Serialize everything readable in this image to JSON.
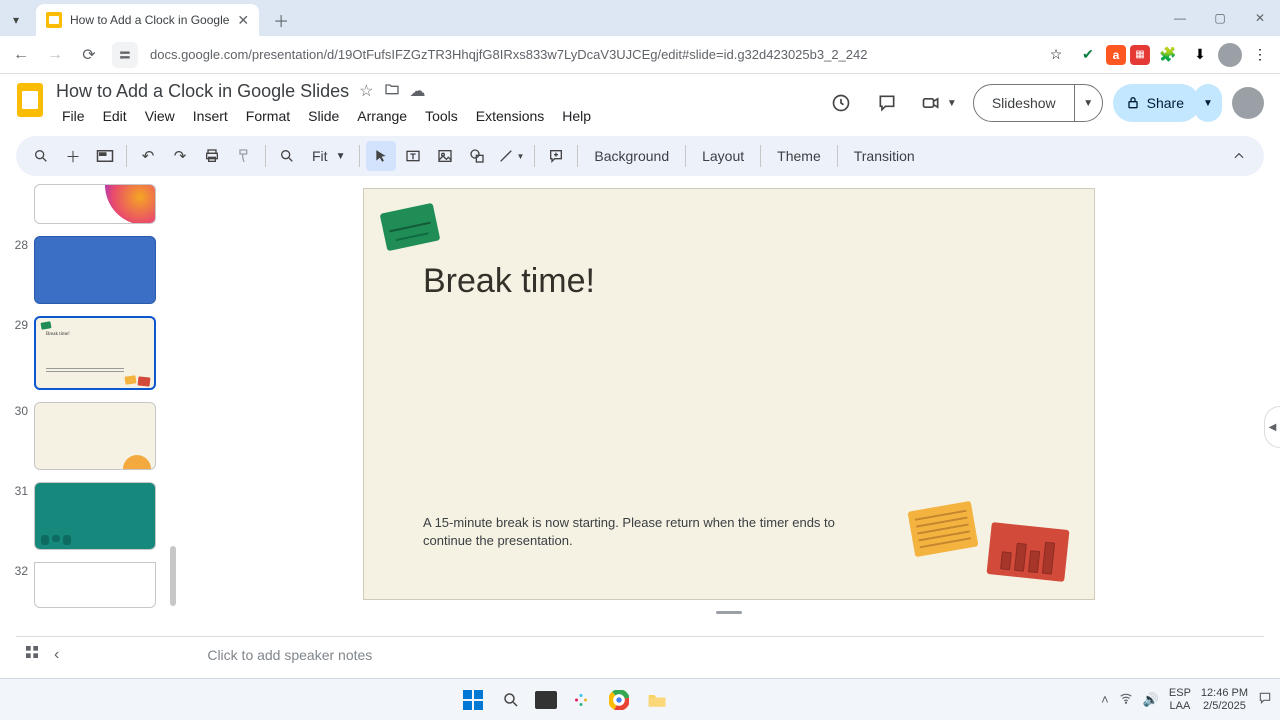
{
  "browser": {
    "tab_title": "How to Add a Clock in Google",
    "url": "docs.google.com/presentation/d/19OtFufsIFZGzTR3HhqjfG8IRxs833w7LyDcaV3UJCEg/edit#slide=id.g32d423025b3_2_242"
  },
  "header": {
    "doc_title": "How to Add a Clock in Google Slides",
    "menus": [
      "File",
      "Edit",
      "View",
      "Insert",
      "Format",
      "Slide",
      "Arrange",
      "Tools",
      "Extensions",
      "Help"
    ],
    "slideshow_label": "Slideshow",
    "share_label": "Share"
  },
  "toolbar": {
    "zoom_label": "Fit",
    "background": "Background",
    "layout": "Layout",
    "theme": "Theme",
    "transition": "Transition"
  },
  "filmstrip": {
    "numbers": [
      "28",
      "29",
      "30",
      "31",
      "32"
    ],
    "selected": 29
  },
  "slide": {
    "title": "Break time!",
    "body": "A 15-minute break is now starting. Please return when the timer ends to continue the presentation."
  },
  "notes": {
    "placeholder": "Click to add speaker notes"
  },
  "taskbar": {
    "lang1": "ESP",
    "lang2": "LAA",
    "time": "12:46 PM",
    "date": "2/5/2025"
  }
}
